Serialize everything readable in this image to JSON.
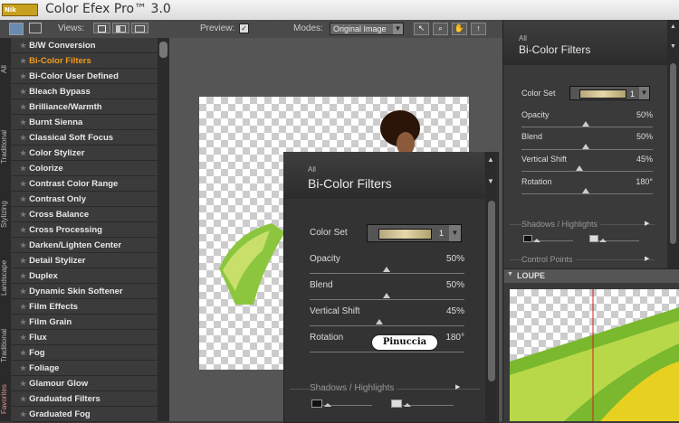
{
  "app": {
    "logo_text": "Nik",
    "title": "Color Efex Pro™ 3.0"
  },
  "toolbar": {
    "views_label": "Views:",
    "preview_label": "Preview:",
    "modes_label": "Modes:",
    "modes_value": "Original Image"
  },
  "vtabs": [
    "All",
    "Traditional",
    "Stylizing",
    "Landscape",
    "Traditional",
    "Favorites"
  ],
  "filters": [
    "B/W Conversion",
    "Bi-Color Filters",
    "Bi-Color User Defined",
    "Bleach Bypass",
    "Brilliance/Warmth",
    "Burnt Sienna",
    "Classical Soft Focus",
    "Color Stylizer",
    "Colorize",
    "Contrast Color Range",
    "Contrast Only",
    "Cross Balance",
    "Cross Processing",
    "Darken/Lighten Center",
    "Detail Stylizer",
    "Duplex",
    "Dynamic Skin Softener",
    "Film Effects",
    "Film Grain",
    "Flux",
    "Fog",
    "Foliage",
    "Glamour Glow",
    "Graduated Filters",
    "Graduated Fog"
  ],
  "selected_filter_index": 1,
  "panel": {
    "category": "All",
    "title": "Bi-Color Filters",
    "color_set_label": "Color Set",
    "color_set_value": "1",
    "opacity_label": "Opacity",
    "opacity_value": "50%",
    "blend_label": "Blend",
    "blend_value": "50%",
    "vshift_label": "Vertical Shift",
    "vshift_value": "45%",
    "rotation_label": "Rotation",
    "rotation_value": "180°",
    "shadows_label": "Shadows / Highlights",
    "control_points_label": "Control Points",
    "watermark": "Pinuccia"
  },
  "right_panel": {
    "category": "All",
    "title": "Bi-Color Filters",
    "color_set_label": "Color Set",
    "color_set_value": "1",
    "opacity_label": "Opacity",
    "opacity_value": "50%",
    "blend_label": "Blend",
    "blend_value": "50%",
    "vshift_label": "Vertical Shift",
    "vshift_value": "45%",
    "rotation_label": "Rotation",
    "rotation_value": "180°",
    "shadows_label": "Shadows / Highlights",
    "control_points_label": "Control Points",
    "loupe_label": "LOUPE"
  },
  "colors": {
    "accent": "#f39a1d",
    "panel_bg": "#333333",
    "list_bg": "#3b3b3b"
  }
}
